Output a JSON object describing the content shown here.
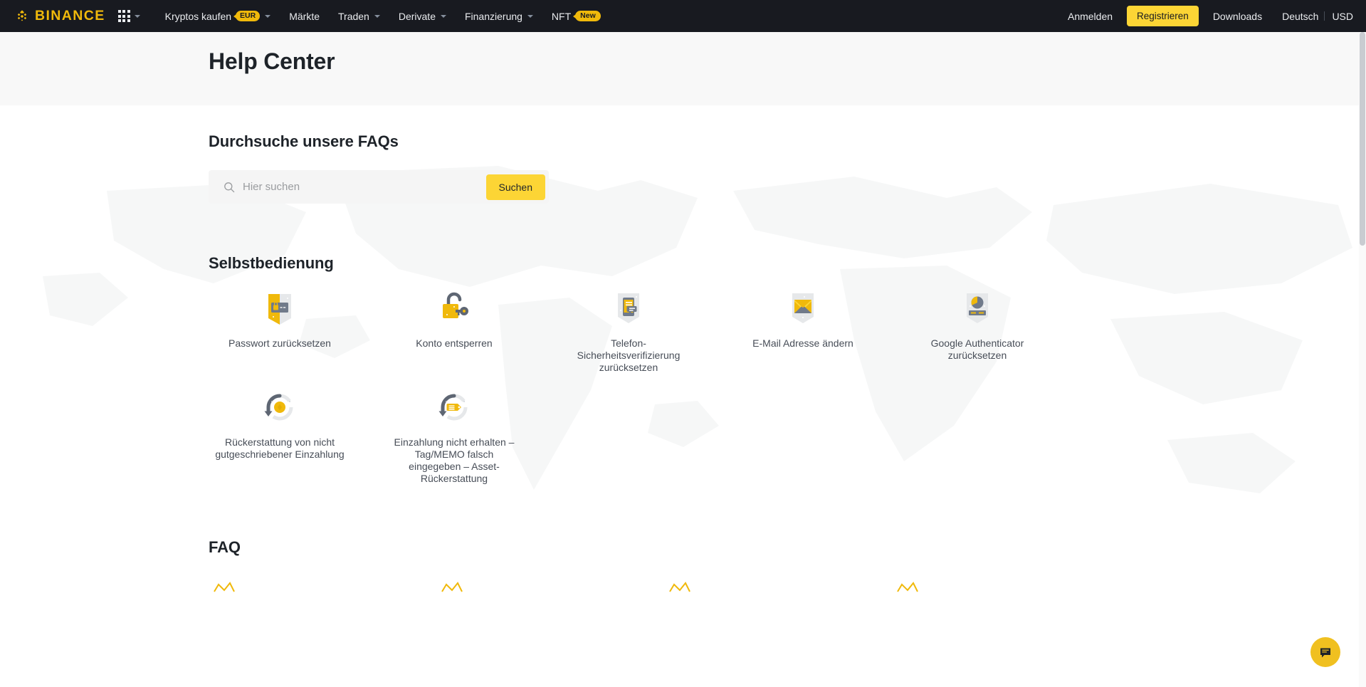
{
  "colors": {
    "nav_bg": "#181a20",
    "brand_yellow": "#f0b90b",
    "accent_yellow": "#fcd535",
    "hero_bg": "#f8f8f8",
    "text_dark": "#1e2329",
    "text_muted": "#474d57",
    "placeholder": "#9a9c9f",
    "chat_fab": "#f0c020"
  },
  "navbar": {
    "brand": "BINANCE",
    "app_grid_icon": "app-grid-icon",
    "links": [
      {
        "label": "Kryptos kaufen",
        "badge": "EUR",
        "caret": true
      },
      {
        "label": "Märkte",
        "badge": null,
        "caret": false
      },
      {
        "label": "Traden",
        "badge": null,
        "caret": true
      },
      {
        "label": "Derivate",
        "badge": null,
        "caret": true
      },
      {
        "label": "Finanzierung",
        "badge": null,
        "caret": true
      },
      {
        "label": "NFT",
        "badge": "New",
        "caret": false
      }
    ],
    "login_label": "Anmelden",
    "register_label": "Registrieren",
    "downloads_label": "Downloads",
    "language_label": "Deutsch",
    "currency_label": "USD"
  },
  "hero": {
    "title": "Help Center"
  },
  "search_section": {
    "title": "Durchsuche unsere FAQs",
    "placeholder": "Hier suchen",
    "value": "",
    "button_label": "Suchen",
    "icon": "search-icon"
  },
  "self_service": {
    "title": "Selbstbedienung",
    "tiles": [
      {
        "label": "Passwort zurücksetzen",
        "icon": "password-reset-icon"
      },
      {
        "label": "Konto entsperren",
        "icon": "unlock-account-icon"
      },
      {
        "label": "Telefon-Sicherheitsverifizierung zurücksetzen",
        "icon": "phone-verification-icon"
      },
      {
        "label": "E-Mail Adresse ändern",
        "icon": "email-change-icon"
      },
      {
        "label": "Google Authenticator zurücksetzen",
        "icon": "authenticator-reset-icon"
      },
      {
        "label": "Rückerstattung von nicht gutgeschriebener Einzahlung",
        "icon": "deposit-refund-icon"
      },
      {
        "label": "Einzahlung nicht erhalten – Tag/MEMO falsch eingegeben – Asset-Rückerstattung",
        "icon": "deposit-memo-icon"
      }
    ]
  },
  "faq_section": {
    "title": "FAQ",
    "cards": [
      {
        "icon": "faq-card-icon-1"
      },
      {
        "icon": "faq-card-icon-2"
      },
      {
        "icon": "faq-card-icon-3"
      },
      {
        "icon": "faq-card-icon-4"
      }
    ]
  },
  "chat": {
    "icon": "chat-bubble-icon"
  }
}
